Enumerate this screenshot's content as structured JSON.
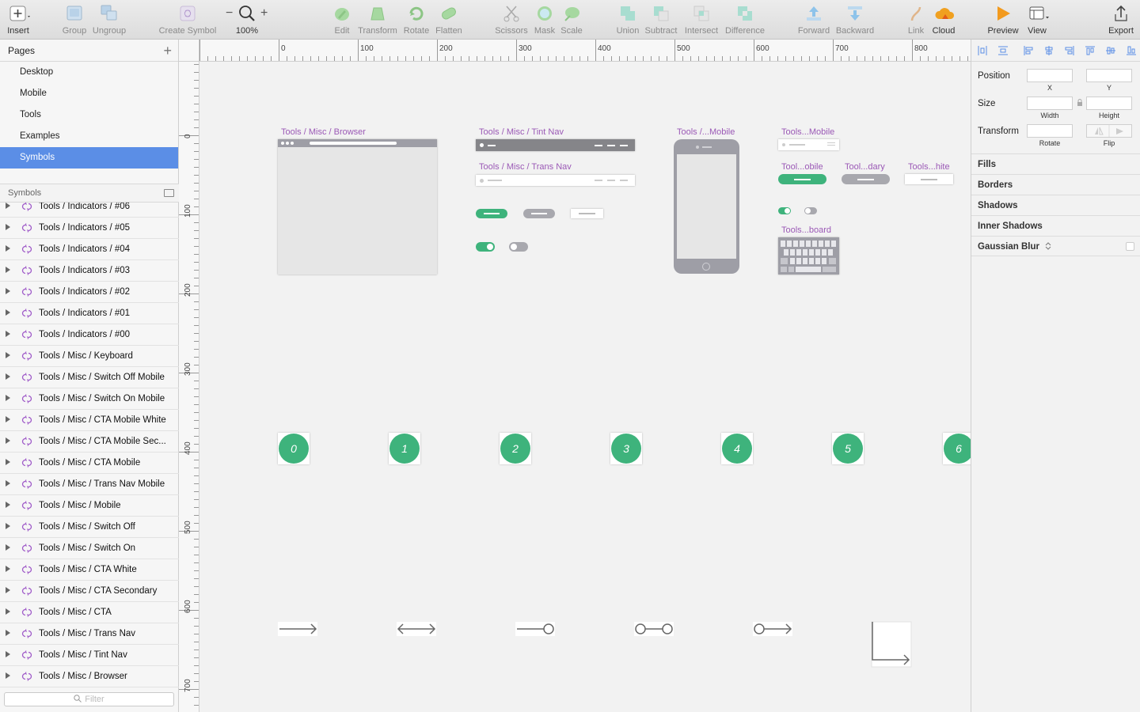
{
  "toolbar": {
    "insert": "Insert",
    "group": "Group",
    "ungroup": "Ungroup",
    "create_symbol": "Create Symbol",
    "zoom_level": "100%",
    "edit": "Edit",
    "transform": "Transform",
    "rotate": "Rotate",
    "flatten": "Flatten",
    "scissors": "Scissors",
    "mask": "Mask",
    "scale": "Scale",
    "union": "Union",
    "subtract": "Subtract",
    "intersect": "Intersect",
    "difference": "Difference",
    "forward": "Forward",
    "backward": "Backward",
    "link": "Link",
    "cloud": "Cloud",
    "preview": "Preview",
    "view": "View",
    "export": "Export"
  },
  "pages": {
    "title": "Pages",
    "items": [
      {
        "label": "Desktop"
      },
      {
        "label": "Mobile"
      },
      {
        "label": "Tools"
      },
      {
        "label": "Examples"
      },
      {
        "label": "Symbols",
        "selected": true
      }
    ]
  },
  "symbols_panel": {
    "title": "Symbols",
    "filter_placeholder": "Filter",
    "layers": [
      "Tools / Indicators / #06",
      "Tools / Indicators / #05",
      "Tools / Indicators / #04",
      "Tools / Indicators / #03",
      "Tools / Indicators / #02",
      "Tools / Indicators / #01",
      "Tools / Indicators / #00",
      "Tools / Misc / Keyboard",
      "Tools / Misc / Switch Off Mobile",
      "Tools / Misc / Switch On Mobile",
      "Tools / Misc / CTA Mobile White",
      "Tools / Misc / CTA Mobile Sec...",
      "Tools / Misc / CTA Mobile",
      "Tools / Misc / Trans Nav Mobile",
      "Tools / Misc / Mobile",
      "Tools / Misc / Switch Off",
      "Tools / Misc / Switch On",
      "Tools / Misc / CTA White",
      "Tools / Misc / CTA Secondary",
      "Tools / Misc / CTA",
      "Tools / Misc / Trans Nav",
      "Tools / Misc / Tint Nav",
      "Tools / Misc / Browser"
    ]
  },
  "rulers": {
    "horizontal": [
      "0",
      "100",
      "200",
      "300",
      "400",
      "500",
      "600",
      "700",
      "800"
    ],
    "vertical": [
      "0",
      "100",
      "200",
      "300",
      "400",
      "500",
      "600",
      "700"
    ]
  },
  "canvas": {
    "artboards": {
      "browser": "Tools / Misc / Browser",
      "tint_nav": "Tools / Misc / Tint Nav",
      "trans_nav": "Tools / Misc / Trans Nav",
      "mobile": "Tools /...Mobile",
      "trans_nav_mobile": "Tools...Mobile",
      "cta_mobile": "Tool...obile",
      "cta_secondary": "Tool...dary",
      "cta_white": "Tools...hite",
      "keyboard": "Tools...board"
    },
    "indicators": [
      "0",
      "1",
      "2",
      "3",
      "4",
      "5",
      "6"
    ]
  },
  "inspector": {
    "position": "Position",
    "x": "X",
    "y": "Y",
    "size": "Size",
    "width": "Width",
    "height": "Height",
    "transform": "Transform",
    "rotate": "Rotate",
    "flip": "Flip",
    "sections": {
      "fills": "Fills",
      "borders": "Borders",
      "shadows": "Shadows",
      "inner_shadows": "Inner Shadows",
      "gaussian_blur": "Gaussian Blur"
    }
  },
  "colors": {
    "accent": "#5b8ee6",
    "green": "#3eb37c",
    "purple": "#9b59b6",
    "nav_gray": "#9e9ea6"
  }
}
